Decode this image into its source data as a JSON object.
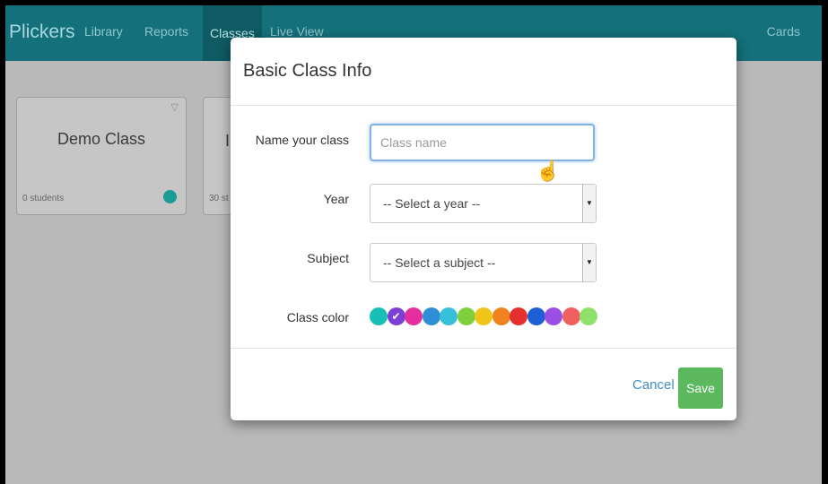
{
  "app": {
    "brand": "Plickers",
    "nav": [
      "Library",
      "Reports",
      "Classes",
      "Live View"
    ],
    "cards_label": "Cards"
  },
  "classes": [
    {
      "title": "Demo Class",
      "count": "0 students",
      "color": "#1a9c95"
    },
    {
      "title": "I",
      "count": "30 st",
      "color": ""
    }
  ],
  "modal": {
    "title": "Basic Class Info",
    "name_label": "Name your class",
    "name_placeholder": "Class name",
    "name_value": "",
    "year_label": "Year",
    "year_selected": "-- Select a year --",
    "subject_label": "Subject",
    "subject_selected": "-- Select a subject --",
    "color_label": "Class color",
    "colors": [
      "#18bfb4",
      "#7c3fd6",
      "#e52f9e",
      "#2f8fd6",
      "#36c0da",
      "#7ed13c",
      "#f0c419",
      "#f0831f",
      "#e5302f",
      "#1f5fd6",
      "#9c4fe5",
      "#f06060",
      "#8ee16a"
    ],
    "selected_color_index": 1,
    "cancel_label": "Cancel",
    "save_label": "Save"
  }
}
